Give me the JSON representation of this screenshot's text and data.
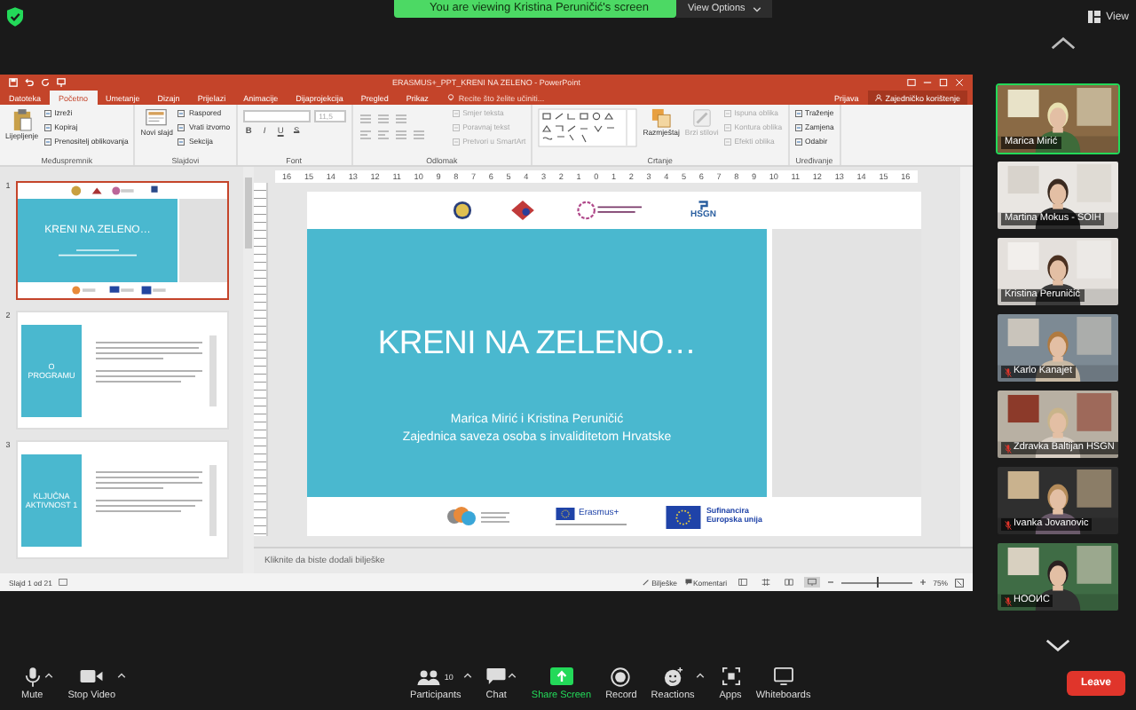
{
  "share_banner": {
    "text": "You are viewing Kristina Peruničić's screen",
    "view_options": "View Options",
    "view": "View"
  },
  "powerpoint": {
    "title": "ERASMUS+_PPT_KRENI NA ZELENO - PowerPoint",
    "tabs": [
      {
        "label": "Datoteka",
        "selected": false
      },
      {
        "label": "Početno",
        "selected": true
      },
      {
        "label": "Umetanje",
        "selected": false
      },
      {
        "label": "Dizajn",
        "selected": false
      },
      {
        "label": "Prijelazi",
        "selected": false
      },
      {
        "label": "Animacije",
        "selected": false
      },
      {
        "label": "Dijaprojekcija",
        "selected": false
      },
      {
        "label": "Pregled",
        "selected": false
      },
      {
        "label": "Prikaz",
        "selected": false
      }
    ],
    "tell_me": "Recite što želite učiniti...",
    "sign_in": "Prijava",
    "share": "Zajedničko korištenje",
    "ribbon_groups": [
      {
        "label": "Međuspremnik",
        "items": [
          {
            "kind": "paste",
            "label": "Lijepljenje",
            "disabled": false
          },
          {
            "kind": "column",
            "commands": [
              {
                "label": "Izreži",
                "disabled": false
              },
              {
                "label": "Kopiraj",
                "disabled": false
              },
              {
                "label": "Prenositelj oblikovanja",
                "disabled": false
              }
            ]
          }
        ]
      },
      {
        "label": "Slajdovi",
        "items": [
          {
            "kind": "new_slide",
            "label": "Novi slajd",
            "disabled": false
          },
          {
            "kind": "column",
            "commands": [
              {
                "label": "Raspored",
                "disabled": false
              },
              {
                "label": "Vrati izvorno",
                "disabled": false
              },
              {
                "label": "Sekcija",
                "disabled": false
              }
            ]
          }
        ]
      },
      {
        "label": "Font",
        "items": [
          {
            "kind": "font",
            "size": "11,5",
            "buttons": [
              "B",
              "I",
              "U",
              "S"
            ]
          }
        ]
      },
      {
        "label": "Odlomak",
        "items": [
          {
            "kind": "paragraph"
          },
          {
            "kind": "column",
            "commands": [
              {
                "label": "Smjer teksta",
                "disabled": true
              },
              {
                "label": "Poravnaj tekst",
                "disabled": true
              },
              {
                "label": "Pretvori u SmartArt",
                "disabled": true
              }
            ]
          }
        ]
      },
      {
        "label": "Crtanje",
        "items": [
          {
            "kind": "gallery"
          },
          {
            "kind": "arrange",
            "label": "Razmještaj",
            "disabled": false
          },
          {
            "kind": "styles",
            "label": "Brzi stilovi",
            "disabled": true
          },
          {
            "kind": "column",
            "commands": [
              {
                "label": "Ispuna oblika",
                "disabled": true
              },
              {
                "label": "Kontura oblika",
                "disabled": true
              },
              {
                "label": "Efekti oblika",
                "disabled": true
              }
            ]
          }
        ]
      },
      {
        "label": "Uređivanje",
        "items": [
          {
            "kind": "column",
            "commands": [
              {
                "label": "Traženje",
                "disabled": false
              },
              {
                "label": "Zamjena",
                "disabled": false
              },
              {
                "label": "Odabir",
                "disabled": false
              }
            ]
          }
        ]
      }
    ],
    "ruler": [
      "16",
      "15",
      "14",
      "13",
      "12",
      "11",
      "10",
      "9",
      "8",
      "7",
      "6",
      "5",
      "4",
      "3",
      "2",
      "1",
      "0",
      "1",
      "2",
      "3",
      "4",
      "5",
      "6",
      "7",
      "8",
      "9",
      "10",
      "11",
      "12",
      "13",
      "14",
      "15",
      "16"
    ],
    "thumbnails": [
      {
        "number": "1",
        "selected": true,
        "kind": "title",
        "title": "KRENI NA ZELENO…"
      },
      {
        "number": "2",
        "selected": false,
        "kind": "content",
        "title": "O PROGRAMU"
      },
      {
        "number": "3",
        "selected": false,
        "kind": "content",
        "title": "KLJUČNA AKTIVNOST 1"
      }
    ],
    "slide": {
      "title": "KRENI NA ZELENO…",
      "authors": "Marica Mirić i Kristina Peruničić",
      "organization": "Zajednica saveza osoba s invaliditetom Hrvatske",
      "top_logo_text": "HSGN",
      "erasmus": "Erasmus+",
      "eu_funding": [
        "Sufinancira",
        "Europska unija"
      ]
    },
    "notes_placeholder": "Kliknite da biste dodali bilješke",
    "status": {
      "slide_count": "Slajd 1 od 21",
      "notes": "Bilješke",
      "comments": "Komentari",
      "views": [
        {
          "kind": "normal",
          "selected": false
        },
        {
          "kind": "sorter",
          "selected": false
        },
        {
          "kind": "reading",
          "selected": false
        },
        {
          "kind": "show",
          "selected": true
        }
      ],
      "zoom_slider": {
        "level": 0.5
      },
      "zoom": "75%"
    }
  },
  "participants": [
    {
      "name": "Marica Mirić",
      "muted": false,
      "speaking": true
    },
    {
      "name": "Martina Mokus - SOIH",
      "muted": false,
      "speaking": false
    },
    {
      "name": "Kristina Peruničić",
      "muted": false,
      "speaking": false
    },
    {
      "name": "Karlo Kanajet",
      "muted": true,
      "speaking": false
    },
    {
      "name": "Zdravka Baltijan HSGN",
      "muted": true,
      "speaking": false
    },
    {
      "name": "Ivanka Jovanovic",
      "muted": true,
      "speaking": false
    },
    {
      "name": "НООИС",
      "muted": true,
      "speaking": false
    }
  ],
  "toolbar": {
    "left": [
      {
        "kind": "mic",
        "label": "Mute",
        "menu": true
      },
      {
        "kind": "video",
        "label": "Stop Video",
        "menu": true
      }
    ],
    "center": [
      {
        "kind": "participants",
        "label": "Participants",
        "count": "10",
        "menu": true
      },
      {
        "kind": "chat",
        "label": "Chat",
        "menu": true
      },
      {
        "kind": "share",
        "label": "Share Screen",
        "menu": false
      },
      {
        "kind": "record",
        "label": "Record",
        "menu": false
      },
      {
        "kind": "reactions",
        "label": "Reactions",
        "menu": true
      },
      {
        "kind": "apps",
        "label": "Apps",
        "menu": false
      },
      {
        "kind": "whiteboards",
        "label": "Whiteboards",
        "menu": false
      }
    ],
    "leave": "Leave"
  }
}
